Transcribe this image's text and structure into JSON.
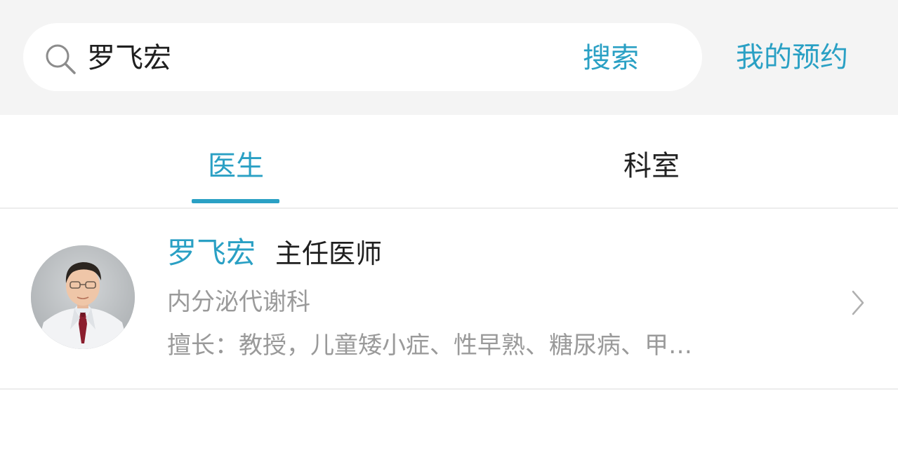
{
  "search": {
    "value": "罗飞宏",
    "button_label": "搜索",
    "icon": "search-icon"
  },
  "header": {
    "appointments_label": "我的预约"
  },
  "tabs": [
    {
      "label": "医生",
      "active": true
    },
    {
      "label": "科室",
      "active": false
    }
  ],
  "results": [
    {
      "name": "罗飞宏",
      "title": "主任医师",
      "department": "内分泌代谢科",
      "specialty": "擅长：教授，儿童矮小症、性早熟、糖尿病、甲…",
      "avatar": "doctor-avatar-photo",
      "chevron_icon": "chevron-right-icon"
    }
  ],
  "colors": {
    "accent": "#2aa0c4",
    "header_background": "#f4f4f4",
    "secondary_text": "#9a9a9a"
  }
}
